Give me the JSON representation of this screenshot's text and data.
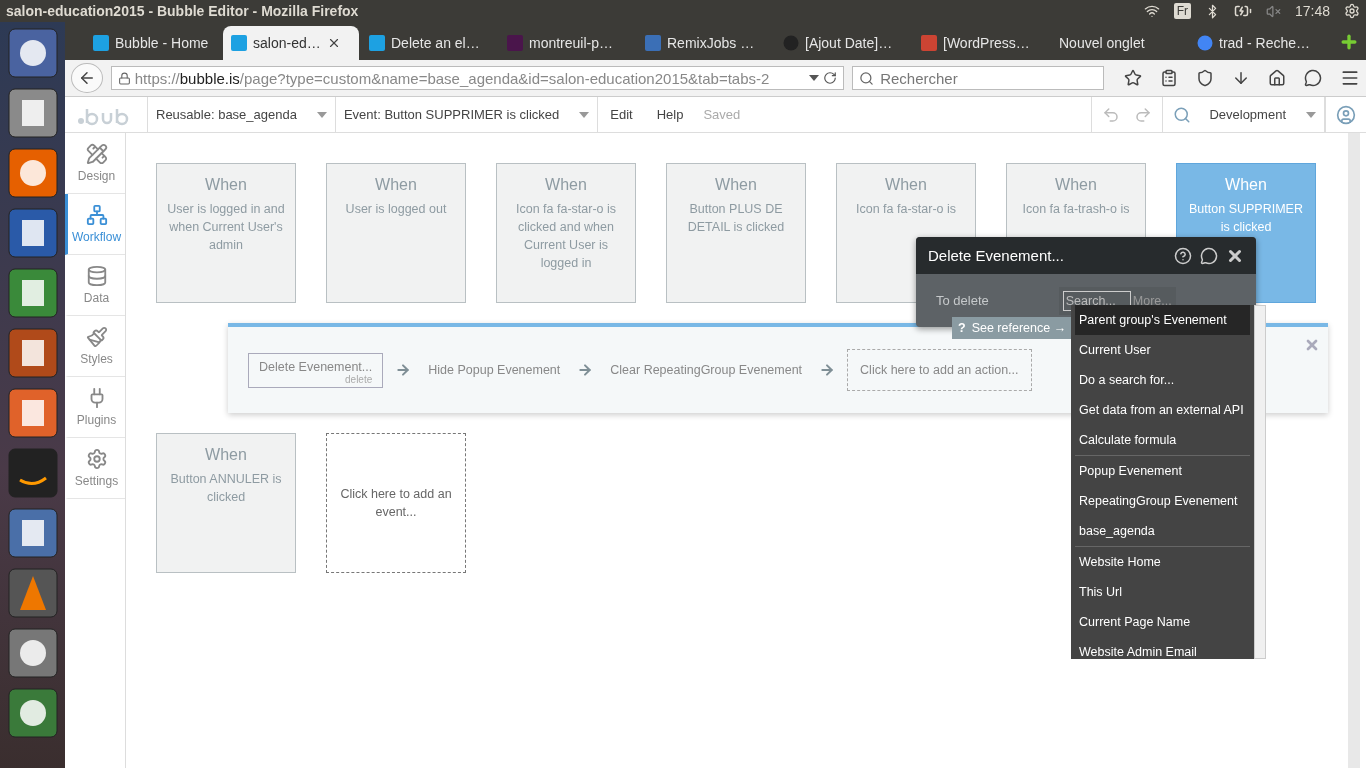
{
  "system_bar": {
    "title": "salon-education2015 - Bubble Editor - Mozilla Firefox",
    "keyboard": "Fr",
    "time": "17:48"
  },
  "browser_tabs": [
    {
      "label": "Bubble - Home",
      "kind": "bubble",
      "selected": false
    },
    {
      "label": "salon-ed…",
      "kind": "bubble",
      "selected": true
    },
    {
      "label": "Delete an el…",
      "kind": "bubble",
      "selected": false
    },
    {
      "label": "montreuil-p…",
      "kind": "hash",
      "selected": false
    },
    {
      "label": "RemixJobs …",
      "kind": "remix",
      "selected": false
    },
    {
      "label": "[Ajout Date]…",
      "kind": "github",
      "selected": false
    },
    {
      "label": "[WordPress…",
      "kind": "wordpress",
      "selected": false
    },
    {
      "label": "Nouvel onglet",
      "kind": "none",
      "selected": false
    },
    {
      "label": "trad - Reche…",
      "kind": "google",
      "selected": false
    }
  ],
  "address": {
    "scheme": "https://",
    "host": "bubble.is",
    "path": "/page?type=custom&name=base_agenda&id=salon-education2015&tab=tabs-2",
    "search_placeholder": "Rechercher"
  },
  "editor_header": {
    "reusable": "Reusable: base_agenda",
    "event": "Event: Button SUPPRIMER is clicked",
    "menu": [
      "Edit",
      "Help"
    ],
    "status": "Saved",
    "environment": "Development"
  },
  "sidebar": [
    {
      "label": "Design",
      "kind": "design",
      "selected": false
    },
    {
      "label": "Workflow",
      "kind": "workflow",
      "selected": true
    },
    {
      "label": "Data",
      "kind": "data",
      "selected": false
    },
    {
      "label": "Styles",
      "kind": "styles",
      "selected": false
    },
    {
      "label": "Plugins",
      "kind": "plugins",
      "selected": false
    },
    {
      "label": "Settings",
      "kind": "settings",
      "selected": false
    }
  ],
  "event_rows": [
    [
      {
        "kind": "event",
        "title": "When",
        "description": "User is logged in and when Current User's admin",
        "selected": false
      },
      {
        "kind": "event",
        "title": "When",
        "description": "User is logged out",
        "selected": false
      },
      {
        "kind": "event",
        "title": "When",
        "description": "Icon fa fa-star-o is clicked and when Current User is logged in",
        "selected": false
      },
      {
        "kind": "event",
        "title": "When",
        "description": "Button PLUS DE DETAIL is clicked",
        "selected": false
      },
      {
        "kind": "event",
        "title": "When",
        "description": "Icon fa fa-star-o is",
        "selected": false
      },
      {
        "kind": "event",
        "title": "When",
        "description": "Icon fa fa-trash-o is",
        "selected": false
      },
      {
        "kind": "event",
        "title": "When",
        "description": "Button SUPPRIMER is clicked",
        "selected": true
      }
    ],
    [
      {
        "kind": "event",
        "title": "When",
        "description": "Button ANNULER is clicked",
        "selected": false
      },
      {
        "kind": "add",
        "description": "Click here to add an event..."
      }
    ]
  ],
  "actions": [
    {
      "kind": "step",
      "label": "Delete Evenement...",
      "sublabel": "delete",
      "selected": true
    },
    {
      "kind": "plain",
      "label": "Hide Popup Evenement",
      "selected": false
    },
    {
      "kind": "plain",
      "label": "Clear RepeatingGroup Evenement",
      "selected": false
    },
    {
      "kind": "add",
      "label": "Click here to add an action..."
    }
  ],
  "action_popup": {
    "title": "Delete Evenement...",
    "field_label": "To delete",
    "search_placeholder": "Search...",
    "more": "More...",
    "reference_icon": "?",
    "reference": "See reference →"
  },
  "dropdown": {
    "groups": [
      [
        {
          "label": "Parent group's Evenement",
          "selected": true
        },
        {
          "label": "Current User",
          "selected": false
        },
        {
          "label": "Do a search for...",
          "selected": false
        },
        {
          "label": "Get data from an external API",
          "selected": false
        },
        {
          "label": "Calculate formula",
          "selected": false
        }
      ],
      [
        {
          "label": "Popup Evenement",
          "selected": false
        },
        {
          "label": "RepeatingGroup Evenement",
          "selected": false
        },
        {
          "label": "base_agenda",
          "selected": false
        }
      ],
      [
        {
          "label": "Website Home",
          "selected": false
        },
        {
          "label": "This Url",
          "selected": false
        },
        {
          "label": "Current Page Name",
          "selected": false
        },
        {
          "label": "Website Admin Email",
          "selected": false
        }
      ]
    ]
  }
}
